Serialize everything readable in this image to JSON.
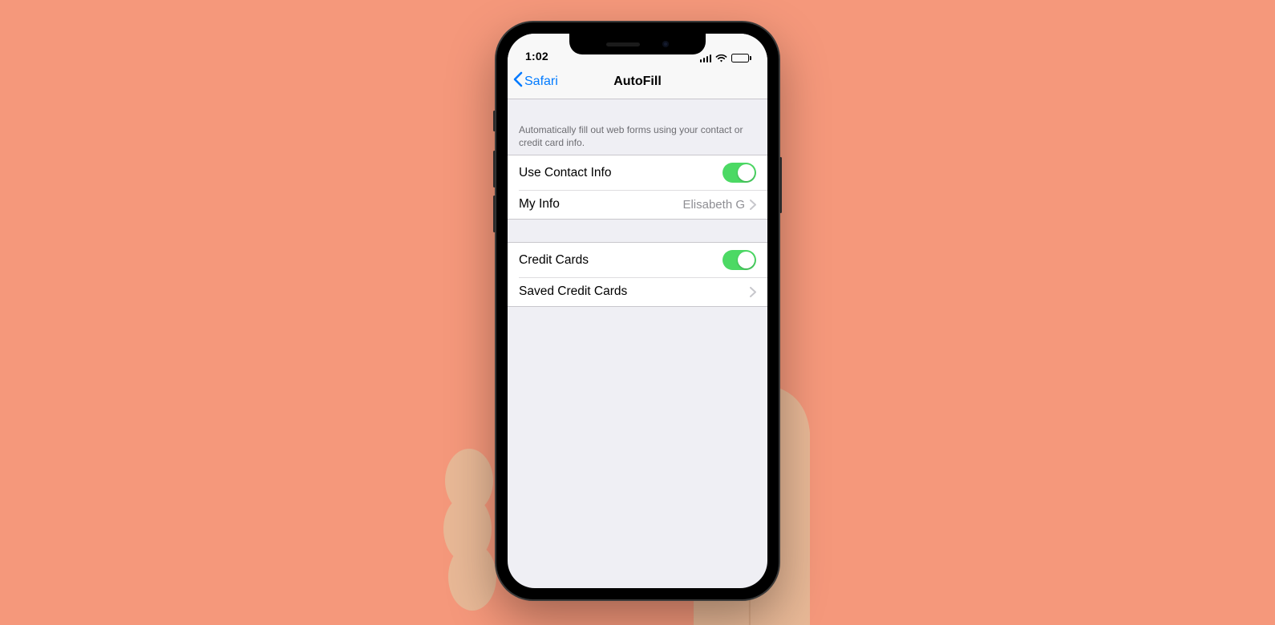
{
  "statusbar": {
    "time": "1:02"
  },
  "nav": {
    "back_label": "Safari",
    "title": "AutoFill"
  },
  "section": {
    "description": "Automatically fill out web forms using your contact or credit card info."
  },
  "contact_group": {
    "use_contact_label": "Use Contact Info",
    "use_contact_on": true,
    "my_info_label": "My Info",
    "my_info_value": "Elisabeth G"
  },
  "card_group": {
    "credit_cards_label": "Credit Cards",
    "credit_cards_on": true,
    "saved_cards_label": "Saved Credit Cards"
  }
}
